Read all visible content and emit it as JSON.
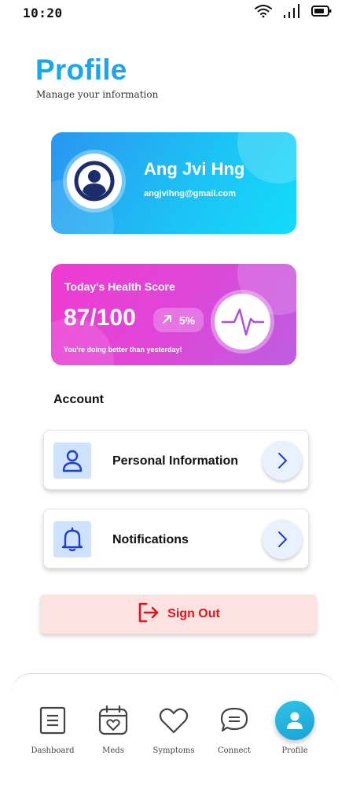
{
  "status_bar": {
    "time": "10:20",
    "icons": [
      "wifi-icon",
      "signal-icon",
      "battery-icon"
    ]
  },
  "header": {
    "title": "Profile",
    "subtitle": "Manage your information"
  },
  "profile_card": {
    "name": "Ang Jvi Hng",
    "email": "angjvihng@gmail.com",
    "avatar_icon": "user-avatar-icon"
  },
  "health_card": {
    "label": "Today's Health Score",
    "score": "87/100",
    "trend": "5%",
    "trend_icon": "arrow-up-right-icon",
    "note": "You're doing better than yesterday!",
    "icon": "heartbeat-icon"
  },
  "account": {
    "title": "Account",
    "items": [
      {
        "label": "Personal Information",
        "icon": "user-icon"
      },
      {
        "label": "Notifications",
        "icon": "bell-icon"
      }
    ]
  },
  "sign_out": {
    "label": "Sign Out",
    "icon": "sign-out-icon"
  },
  "bottom_nav": {
    "items": [
      {
        "label": "Dashboard",
        "icon": "dashboard-icon",
        "active": false
      },
      {
        "label": "Meds",
        "icon": "calendar-heart-icon",
        "active": false
      },
      {
        "label": "Symptoms",
        "icon": "heart-icon",
        "active": false
      },
      {
        "label": "Connect",
        "icon": "chat-icon",
        "active": false
      },
      {
        "label": "Profile",
        "icon": "profile-icon",
        "active": true
      }
    ]
  },
  "colors": {
    "accent": "#1aa6ea",
    "profile_gradient": [
      "#2a95f0",
      "#12dcfb"
    ],
    "health_gradient": [
      "#f03ad1",
      "#be5ee0"
    ],
    "signout_text": "#e8141c",
    "signout_bg": "#fde2e2"
  }
}
